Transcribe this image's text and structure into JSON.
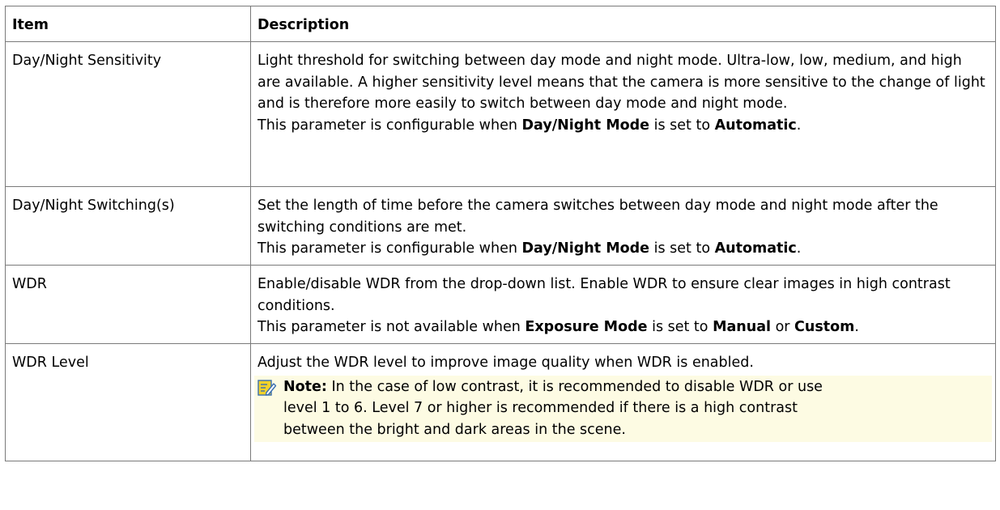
{
  "table": {
    "headers": {
      "item": "Item",
      "description": "Description"
    },
    "rows": [
      {
        "item": "Day/Night Sensitivity",
        "desc1": "Light threshold for switching between day mode and night mode. Ultra-low, low, medium, and high are available. A higher sensitivity level means that the camera is more sensitive to the change of light and is therefore more easily to switch between day mode and night mode.",
        "cond_pre": "This parameter is configurable when ",
        "cond_b1": "Day/Night Mode",
        "cond_mid": " is set to ",
        "cond_b2": "Automatic",
        "cond_end": "."
      },
      {
        "item": "Day/Night Switching(s)",
        "desc1": "Set the length of time before the camera switches between day mode and night mode after the switching conditions are met.",
        "cond_pre": "This parameter is configurable when ",
        "cond_b1": "Day/Night Mode",
        "cond_mid": " is set to ",
        "cond_b2": "Automatic",
        "cond_end": "."
      },
      {
        "item": "WDR",
        "desc1": "Enable/disable WDR from the drop-down list. Enable WDR to ensure clear images in high contrast conditions.",
        "cond_pre": "This parameter is not available when ",
        "cond_b1": "Exposure Mode",
        "cond_mid": " is set to ",
        "cond_b2": "Manual",
        "cond_or": " or ",
        "cond_b3": "Custom",
        "cond_end": "."
      },
      {
        "item": "WDR Level",
        "desc1": "Adjust the WDR level to improve image quality when WDR is enabled.",
        "note_label": "Note:",
        "note_text": " In the case of low contrast, it is recommended to disable WDR or use level 1 to 6. Level 7 or higher is recommended if there is a high contrast between the bright and dark areas in the scene."
      }
    ]
  },
  "icons": {
    "note": "note-pencil-icon"
  },
  "colors": {
    "border": "#7a7a7a",
    "note_background": "#fdfbe3",
    "note_icon_fill": "#f2d22a",
    "note_icon_stroke": "#3a6fb0"
  }
}
